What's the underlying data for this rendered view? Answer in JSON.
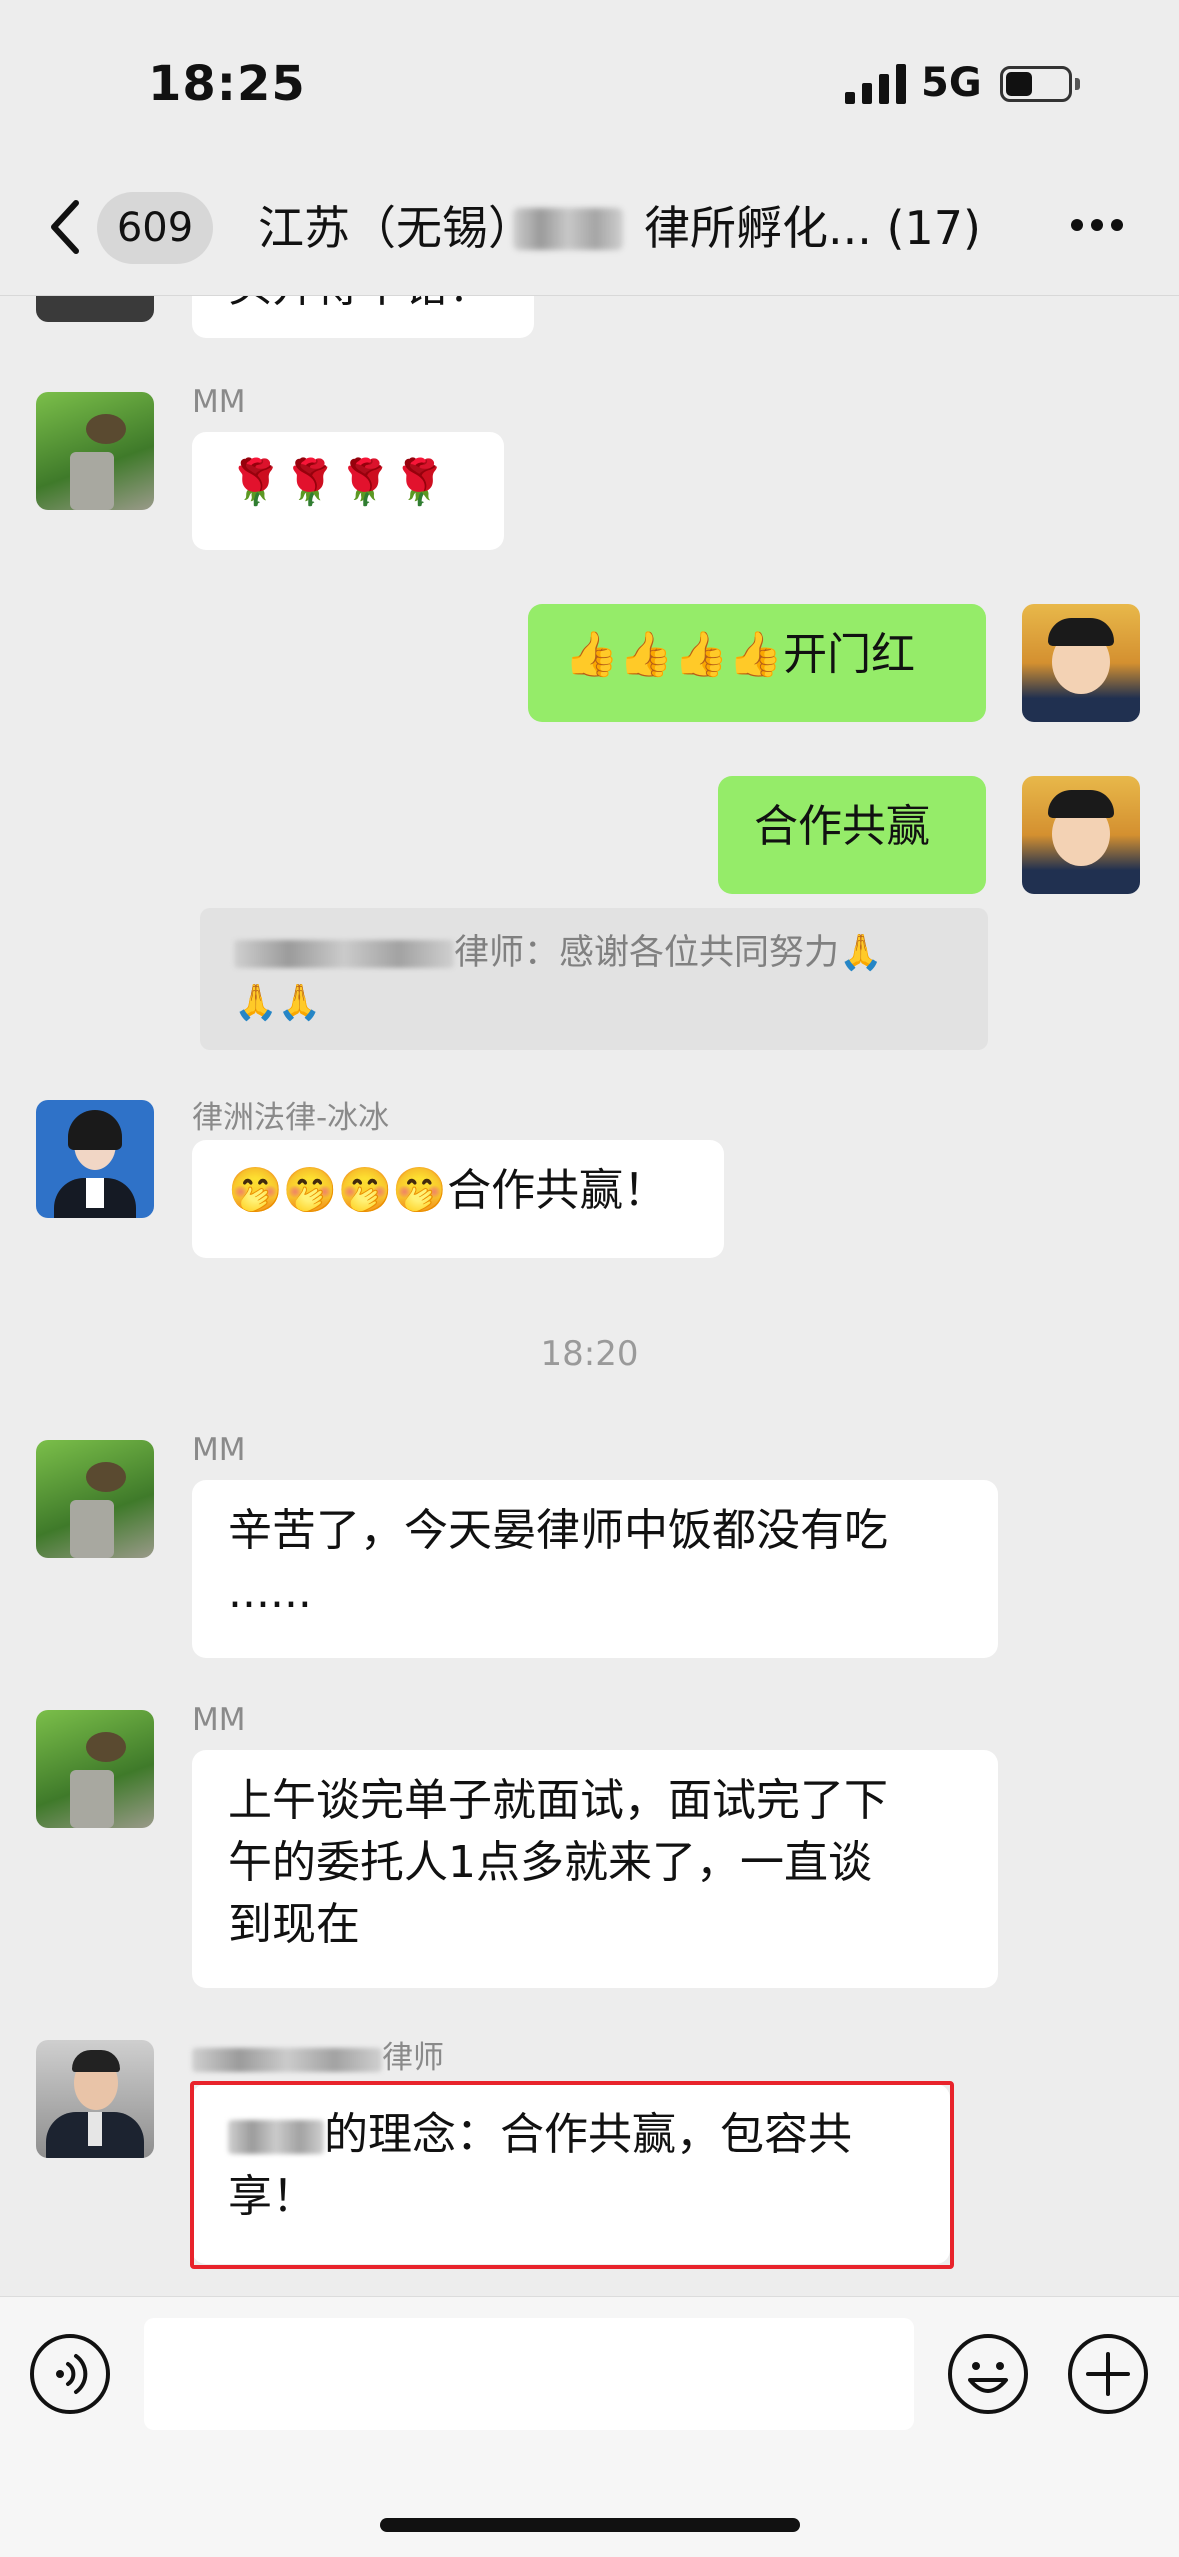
{
  "status_bar": {
    "time": "18:25",
    "network": "5G"
  },
  "nav": {
    "unread_count": "609",
    "title_prefix": "江苏（无锡）",
    "title_suffix": "律所孵化...",
    "member_count": "(17)"
  },
  "messages": [
    {
      "sender": "MM",
      "text": "🌹🌹🌹🌹"
    },
    {
      "sender": "me",
      "text_emoji": "👍👍👍👍",
      "text": "开门红"
    },
    {
      "sender": "me",
      "text": "合作共赢"
    },
    {
      "quote_sender_suffix": "律师：",
      "quote_text": "感谢各位共同努力🙏",
      "quote_emoji": "🙏🙏"
    },
    {
      "sender": "律洲法律-冰冰",
      "text_emoji": "🤭🤭🤭🤭",
      "text": "合作共赢！"
    },
    {
      "timestamp": "18:20"
    },
    {
      "sender": "MM",
      "text_line1": "辛苦了，今天晏律师中饭都没有吃",
      "text_line2": "......"
    },
    {
      "sender": "MM",
      "text_line1": "上午谈完单子就面试，面试完了下",
      "text_line2": "午的委托人1点多就来了，一直谈",
      "text_line3": "到现在"
    },
    {
      "sender_suffix": "律师",
      "text_line1": "的理念：合作共赢，包容共",
      "text_line2": "享！"
    }
  ],
  "partial_top_message": "头开得不错！",
  "colors": {
    "my_bubble": "#95ec69",
    "highlight": "#e8232b",
    "background": "#ededed"
  },
  "icons": [
    "back-icon",
    "more-icon",
    "voice-icon",
    "emoji-icon",
    "plus-icon",
    "signal-icon",
    "battery-icon"
  ]
}
